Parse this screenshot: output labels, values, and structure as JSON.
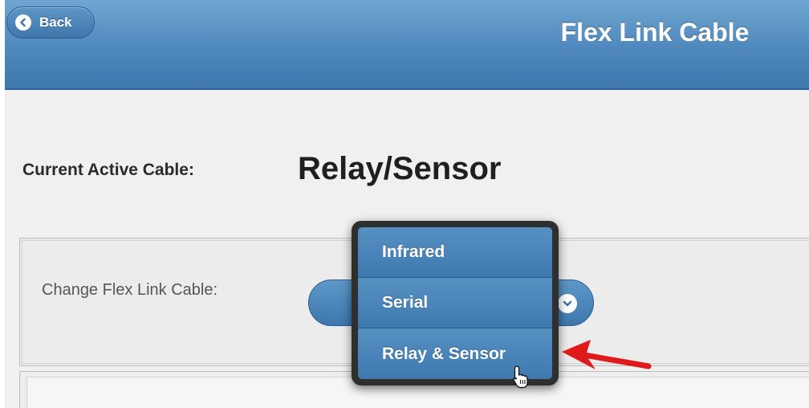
{
  "header": {
    "back_label": "Back",
    "title": "Flex Link Cable"
  },
  "current": {
    "label": "Current Active Cable:",
    "value": "Relay/Sensor"
  },
  "change": {
    "label": "Change Flex Link Cable:"
  },
  "menu": {
    "items": [
      {
        "label": "Infrared"
      },
      {
        "label": "Serial"
      },
      {
        "label": "Relay & Sensor"
      }
    ]
  },
  "icons": {
    "back": "chevron-left-icon",
    "select": "chevron-down-icon",
    "cursor": "hand-pointer-icon",
    "annotation": "red-arrow-icon"
  },
  "colors": {
    "header": "#4f88bd",
    "button": "#4a84ba",
    "annotation_arrow": "#e01a1a"
  }
}
